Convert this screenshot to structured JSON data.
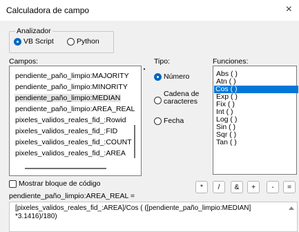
{
  "window": {
    "title": "Calculadora de campo",
    "close_glyph": "×"
  },
  "parser": {
    "label": "Analizador",
    "options": [
      "VB Script",
      "Python"
    ],
    "selected": "VB Script"
  },
  "fields": {
    "label": "Campos:",
    "items": [
      "pendiente_paño_limpio:MAJORITY",
      "pendiente_paño_limpio:MINORITY",
      "pendiente_paño_limpio:MEDIAN",
      "pendiente_paño_limpio:AREA_REAL",
      "pixeles_validos_reales_fid_:Rowid",
      "pixeles_validos_reales_fid_:FID",
      "pixeles_validos_reales_fid_:COUNT",
      "pixeles_validos_reales_fid_:AREA"
    ],
    "selected": "pendiente_paño_limpio:MEDIAN"
  },
  "type": {
    "label": "Tipo:",
    "options": [
      "Número",
      "Cadena de caracteres",
      "Fecha"
    ],
    "selected": "Número"
  },
  "functions": {
    "label": "Funciones:",
    "items": [
      "Abs ( )",
      "Atn ( )",
      "Cos ( )",
      "Exp ( )",
      "Fix ( )",
      "Int ( )",
      "Log ( )",
      "Sin ( )",
      "Sqr ( )",
      "Tan ( )"
    ],
    "selected": "Cos ( )"
  },
  "codeblock": {
    "label": "Mostrar bloque de código",
    "checked": false
  },
  "operators": [
    "*",
    "/",
    "&",
    "+",
    "-",
    "="
  ],
  "expression": {
    "label": "pendiente_paño_limpio:AREA_REAL =",
    "value": "[pixeles_validos_reales_fid_:AREA]/Cos ( ([pendiente_paño_limpio:MEDIAN]\n*3.1416)/180)"
  },
  "colors": {
    "accent": "#0078d7",
    "background": "#f0f0f0"
  }
}
